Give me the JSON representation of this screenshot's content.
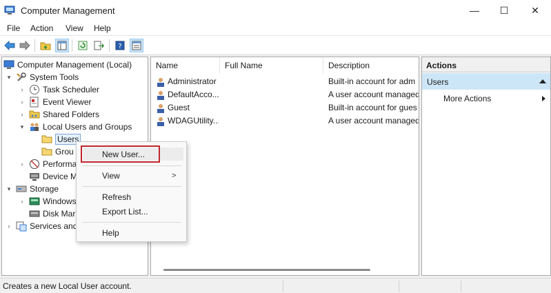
{
  "window": {
    "title": "Computer Management",
    "minimize_glyph": "—",
    "maximize_glyph": "☐",
    "close_glyph": "✕"
  },
  "menubar": {
    "items": [
      "File",
      "Action",
      "View",
      "Help"
    ]
  },
  "toolbar": {
    "buttons": [
      "back-arrow-icon",
      "forward-arrow-icon",
      "up-folder-icon",
      "show-hide-tree-icon",
      "refresh-icon",
      "export-icon",
      "help-icon",
      "properties-icon"
    ]
  },
  "tree": {
    "root": "Computer Management (Local)",
    "system_tools": "System Tools",
    "task_scheduler": "Task Scheduler",
    "event_viewer": "Event Viewer",
    "shared_folders": "Shared Folders",
    "local_users_groups": "Local Users and Groups",
    "users": "Users",
    "groups": "Grou",
    "performance": "Performa",
    "device_manager": "Device M",
    "storage": "Storage",
    "windows_backup": "Windows",
    "disk_management": "Disk Mar",
    "services_apps": "Services and"
  },
  "list": {
    "columns": [
      "Name",
      "Full Name",
      "Description"
    ],
    "rows": [
      {
        "name": "Administrator",
        "full_name": "",
        "description": "Built-in account for adm"
      },
      {
        "name": "DefaultAcco...",
        "full_name": "",
        "description": "A user account managed"
      },
      {
        "name": "Guest",
        "full_name": "",
        "description": "Built-in account for gues"
      },
      {
        "name": "WDAGUtility...",
        "full_name": "",
        "description": "A user account managed"
      }
    ]
  },
  "actions": {
    "header": "Actions",
    "section": "Users",
    "more_actions": "More Actions"
  },
  "context_menu": {
    "new_user": "New User...",
    "view": "View",
    "view_arrow": ">",
    "refresh": "Refresh",
    "export_list": "Export List...",
    "help": "Help"
  },
  "statusbar": {
    "text": "Creates a new Local User account."
  },
  "colors": {
    "highlight_box": "#c1272d",
    "selection": "#cde6f7"
  }
}
